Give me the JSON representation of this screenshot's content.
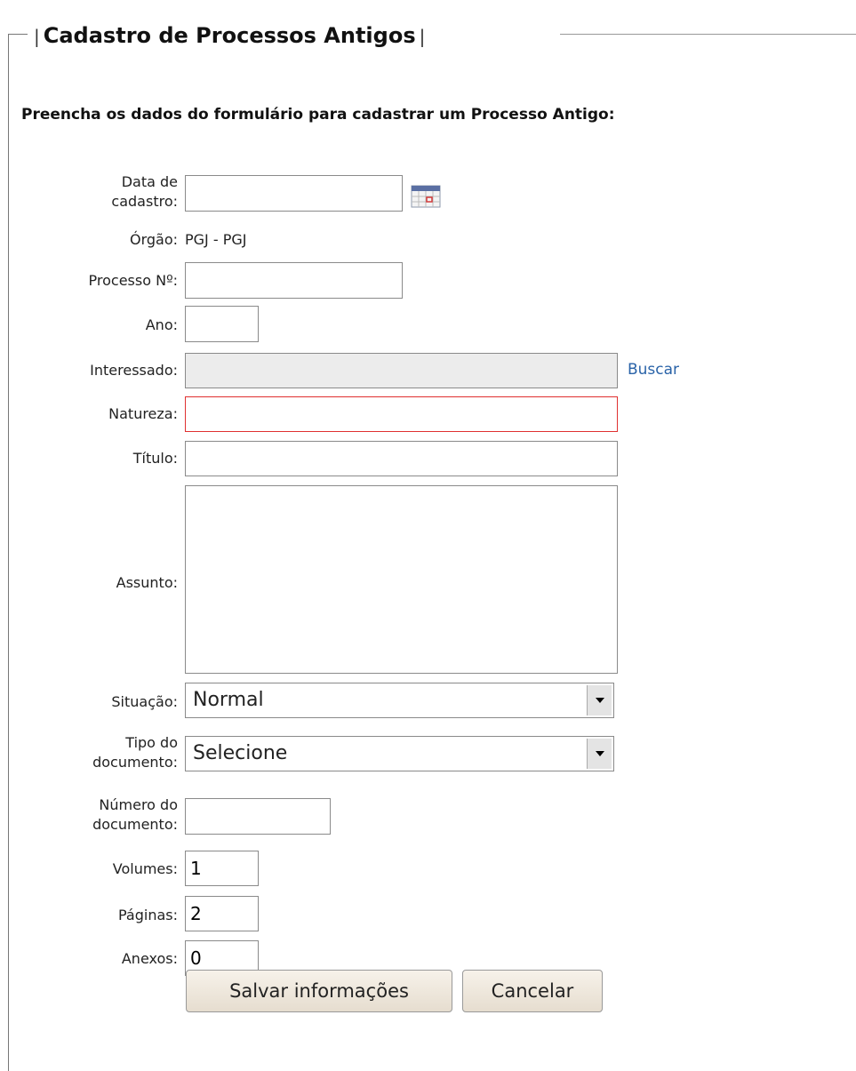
{
  "legend": {
    "title": "Cadastro de Processos Antigos",
    "bar": "|"
  },
  "intro": "Preencha os dados do formulário para cadastrar um Processo Antigo:",
  "fields": {
    "data_cadastro": {
      "label_line1": "Data de",
      "label_line2": "cadastro:",
      "value": ""
    },
    "orgao": {
      "label": "Órgão:",
      "value": "PGJ - PGJ"
    },
    "processo": {
      "label": "Processo Nº:",
      "value": ""
    },
    "ano": {
      "label": "Ano:",
      "value": ""
    },
    "interessado": {
      "label": "Interessado:",
      "value": "",
      "link": "Buscar"
    },
    "natureza": {
      "label": "Natureza:",
      "value": ""
    },
    "titulo": {
      "label": "Título:",
      "value": ""
    },
    "assunto": {
      "label": "Assunto:",
      "value": ""
    },
    "situacao": {
      "label": "Situação:",
      "selected": "Normal"
    },
    "tipo_documento": {
      "label_line1": "Tipo do",
      "label_line2": "documento:",
      "selected": "Selecione"
    },
    "numero_documento": {
      "label_line1": "Número do",
      "label_line2": "documento:",
      "value": ""
    },
    "volumes": {
      "label": "Volumes:",
      "value": "1"
    },
    "paginas": {
      "label": "Páginas:",
      "value": "2"
    },
    "anexos": {
      "label": "Anexos:",
      "value": "0"
    }
  },
  "buttons": {
    "save": "Salvar informações",
    "cancel": "Cancelar"
  },
  "icons": {
    "calendar": "calendar-icon",
    "dropdown": "chevron-down-icon"
  },
  "colors": {
    "link": "#2a63a8",
    "error_border": "#e03030",
    "disabled_bg": "#ececec"
  }
}
